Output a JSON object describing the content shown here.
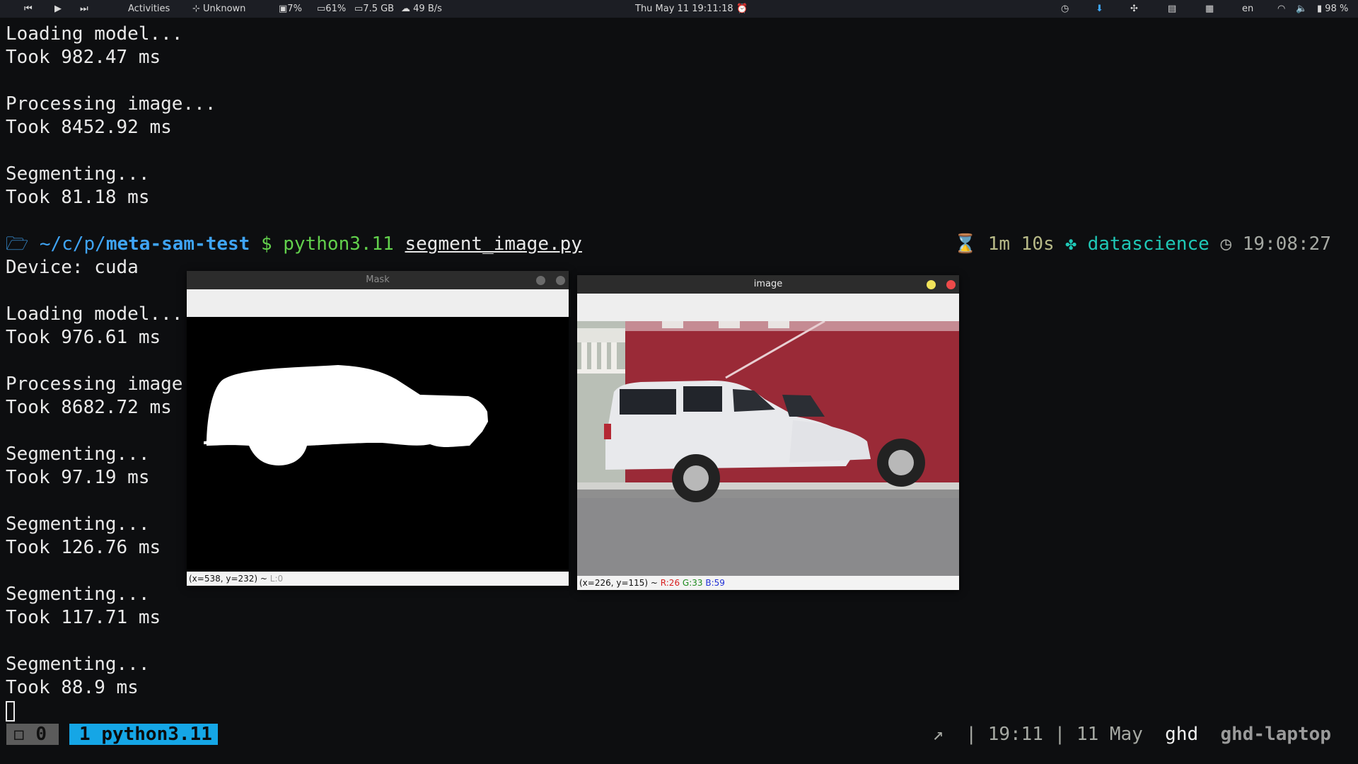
{
  "topbar": {
    "activities": "Activities",
    "network_label": "Unknown",
    "cpu": "7%",
    "memory": "61%",
    "memory_size": "7.5 GB",
    "net_speed": "49 B/s",
    "datetime": "Thu May 11  19:11:18",
    "lang": "en",
    "battery": "98 %"
  },
  "terminal": {
    "prev_output": [
      "Loading model...",
      "Took 982.47 ms",
      "",
      "Processing image...",
      "Took 8452.92 ms",
      "",
      "Segmenting...",
      "Took 81.18 ms"
    ],
    "prompt": {
      "path_prefix": "~/c/p/",
      "path_dir": "meta-sam-test",
      "symbol": "$",
      "command": "python3.11",
      "argument": "segment_image.py",
      "duration": "1m 10s",
      "env": "datascience",
      "time": "19:08:27"
    },
    "output": [
      "Device: cuda",
      "",
      "Loading model...",
      "Took 976.61 ms",
      "",
      "Processing image.",
      "Took 8682.72 ms",
      "",
      "Segmenting...",
      "Took 97.19 ms",
      "",
      "Segmenting...",
      "Took 126.76 ms",
      "",
      "Segmenting...",
      "Took 117.71 ms",
      "",
      "Segmenting...",
      "Took 88.9 ms"
    ]
  },
  "mask_window": {
    "title": "Mask",
    "status": "(x=538, y=232) ~ ",
    "status_value": "L:0"
  },
  "image_window": {
    "title": "image",
    "status": "(x=226, y=115) ~ ",
    "r": "R:26",
    "g": "G:33",
    "b": "B:59"
  },
  "tmux": {
    "session": "0",
    "window_index": "1",
    "window_name": "python3.11",
    "arrow": "↗",
    "time": "19:11",
    "date": "11 May",
    "user": "ghd",
    "host": "ghd-laptop"
  }
}
